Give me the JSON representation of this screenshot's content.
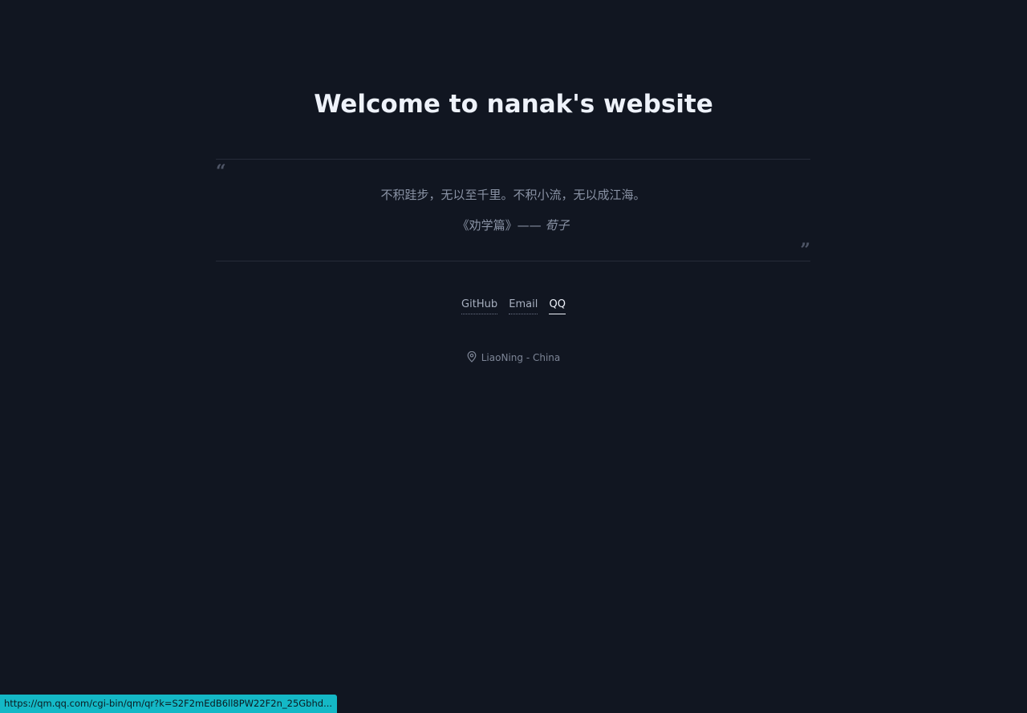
{
  "header": {
    "title": "Welcome to nanak's website"
  },
  "quote": {
    "open_mark": "“",
    "close_mark": "”",
    "text": "不积跬步，无以至千里。不积小流，无以成江海。",
    "source_work": "《劝学篇》—— ",
    "source_author": "荀子"
  },
  "links": [
    {
      "label": "GitHub"
    },
    {
      "label": "Email"
    },
    {
      "label": "QQ"
    }
  ],
  "location": {
    "icon": "map-pin-icon",
    "text": "LiaoNing - China"
  },
  "status_bar": {
    "url": "https://qm.qq.com/cgi-bin/qm/qr?k=S2F2mEdB6ll8PW22F2n_25Gbhd..."
  },
  "colors": {
    "background": "#111621",
    "status_bar": "#14b8c6"
  }
}
